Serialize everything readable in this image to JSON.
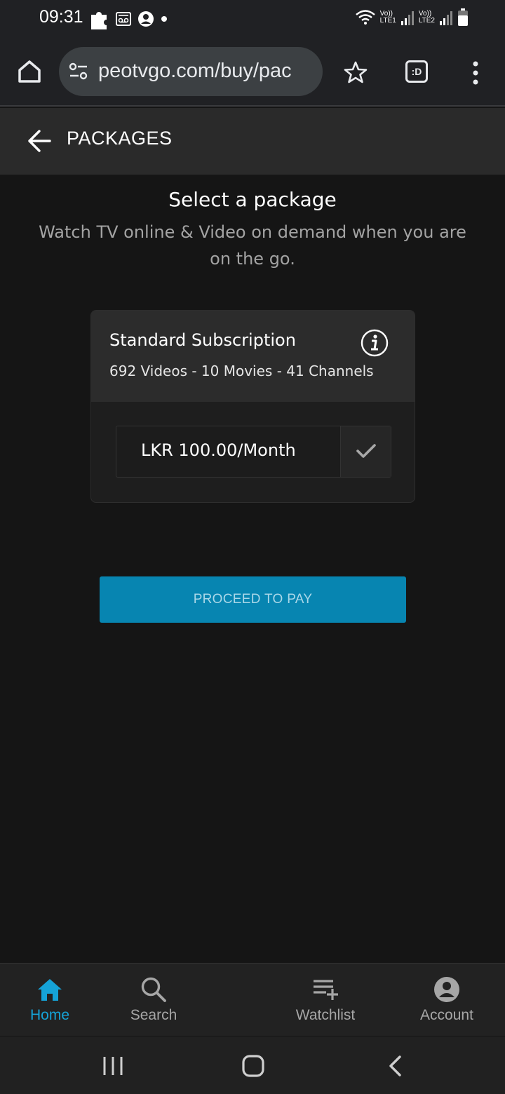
{
  "status_bar": {
    "time": "09:31",
    "sim1_label": "Vo))\nLTE1",
    "sim2_label": "Vo))\nLTE2"
  },
  "browser": {
    "url": "peotvgo.com/buy/pac",
    "tab_switcher_label": ":D"
  },
  "header": {
    "title": "PACKAGES"
  },
  "main": {
    "title": "Select a package",
    "subtitle": "Watch TV online & Video on demand when you are on the go."
  },
  "package": {
    "name": "Standard Subscription",
    "details": "692 Videos - 10 Movies - 41 Channels",
    "price": "LKR 100.00/Month"
  },
  "proceed_label": "PROCEED TO PAY",
  "bottom_nav": {
    "items": [
      {
        "label": "Home",
        "icon": "home-icon",
        "active": true
      },
      {
        "label": "Search",
        "icon": "search-icon",
        "active": false
      },
      {
        "label": "Watchlist",
        "icon": "playlist-add-icon",
        "active": false
      },
      {
        "label": "Account",
        "icon": "account-icon",
        "active": false
      }
    ]
  },
  "colors": {
    "accent": "#15a3d8",
    "button": "#0785b1",
    "background": "#151515"
  }
}
